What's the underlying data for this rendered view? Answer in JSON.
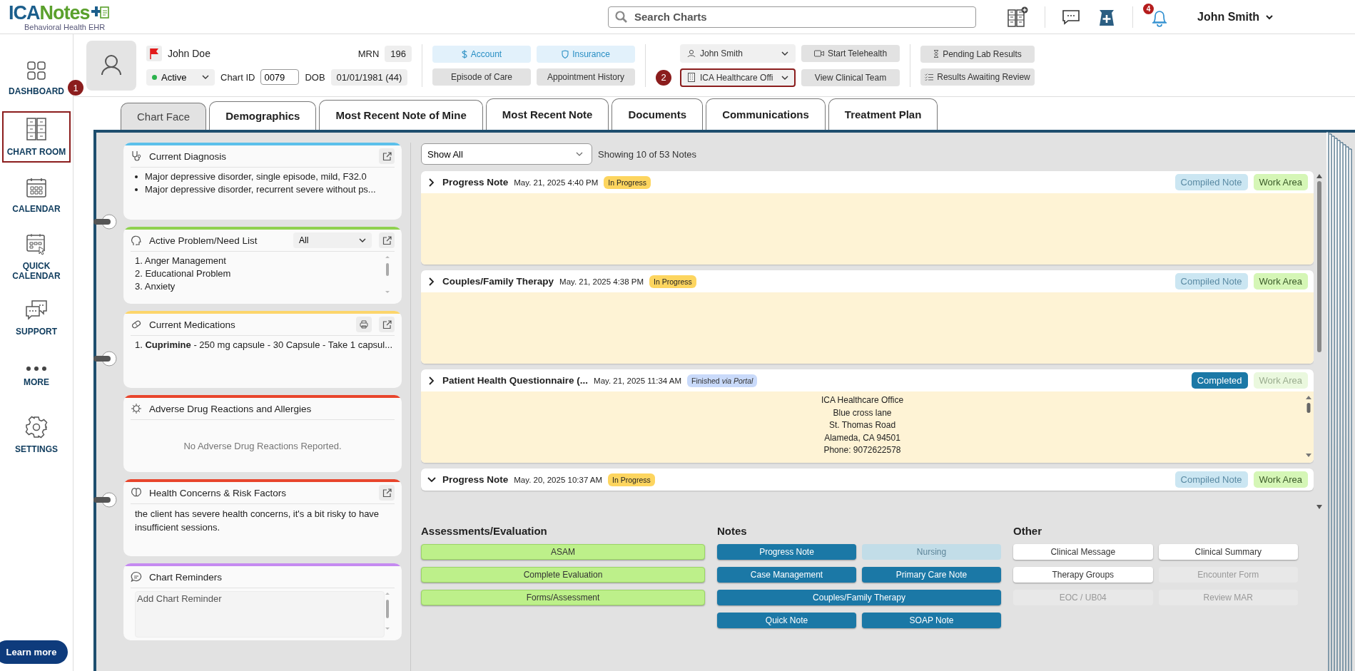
{
  "header": {
    "logo": {
      "brand_1": "ICA",
      "brand_2": "Notes",
      "tagline": "Behavioral Health EHR"
    },
    "search": {
      "placeholder": "Search Charts"
    },
    "notification_count": "4",
    "user": "John Smith"
  },
  "sidebar": {
    "items": [
      {
        "label": "DASHBOARD",
        "kind": "dashboard",
        "highlighted": false
      },
      {
        "label": "CHART ROOM",
        "kind": "chartroom",
        "highlighted": true
      },
      {
        "label": "CALENDAR",
        "kind": "calendar",
        "highlighted": false
      },
      {
        "label": "QUICK CALENDAR",
        "kind": "quickcal",
        "highlighted": false
      },
      {
        "label": "SUPPORT",
        "kind": "support",
        "highlighted": false
      },
      {
        "label": "MORE",
        "kind": "more",
        "highlighted": false
      },
      {
        "label": "SETTINGS",
        "kind": "settings",
        "highlighted": false
      }
    ],
    "learn_more": "Learn more"
  },
  "callouts": [
    "1",
    "2"
  ],
  "patient": {
    "name": "John Doe",
    "flagged": true,
    "status": "Active",
    "chart_id_label": "Chart ID",
    "chart_id": "0079",
    "mrn_label": "MRN",
    "mrn": "196",
    "dob_label": "DOB",
    "dob": "01/01/1981 (44)"
  },
  "patient_actions": {
    "account": "Account",
    "insurance": "Insurance",
    "episode": "Episode of Care",
    "appointments": "Appointment History",
    "clinician": "John Smith",
    "office": {
      "value": "ICA Healthcare Offi",
      "highlighted": true
    },
    "telehealth": "Start Telehealth",
    "clinical_team": "View Clinical Team",
    "pending_labs": "Pending Lab Results",
    "results_review": "Results Awaiting Review"
  },
  "tabs": [
    {
      "label": "Chart Face",
      "selected": true
    },
    {
      "label": "Demographics",
      "selected": false
    },
    {
      "label": "Most Recent Note of Mine",
      "selected": false
    },
    {
      "label": "Most Recent Note",
      "selected": false
    },
    {
      "label": "Documents",
      "selected": false
    },
    {
      "label": "Communications",
      "selected": false
    },
    {
      "label": "Treatment Plan",
      "selected": false
    }
  ],
  "cards": [
    {
      "kind": "diagnosis",
      "title": "Current Diagnosis",
      "color": "#5bc0eb",
      "items": [
        "Major depressive disorder, single episode, mild, F32.0",
        "Major depressive disorder, recurrent severe without ps..."
      ]
    },
    {
      "kind": "problems",
      "title": "Active Problem/Need List",
      "color": "#8fd14f",
      "filter": "All",
      "items": [
        "1. Anger Management",
        "2. Educational Problem",
        "3. Anxiety"
      ]
    },
    {
      "kind": "medications",
      "title": "Current Medications",
      "color": "#fcd56b",
      "items": [
        "1. **Cuprimine** - 250 mg capsule - 30 Capsule - Take 1 capsul..."
      ]
    },
    {
      "kind": "allergies",
      "title": "Adverse Drug Reactions and Allergies",
      "color": "#e8452c",
      "message": "No Adverse Drug Reactions Reported."
    },
    {
      "kind": "concerns",
      "title": "Health Concerns & Risk Factors",
      "color": "#e8452c",
      "text": "the client has severe health concerns, it's a bit risky to have insufficient sessions."
    },
    {
      "kind": "reminders",
      "title": "Chart Reminders",
      "color": "#c58af0",
      "placeholder": "Add Chart Reminder"
    }
  ],
  "notes_filter": {
    "value": "Show All",
    "summary": "Showing 10 of 53 Notes"
  },
  "notes": [
    {
      "title": "Progress Note",
      "date": "May. 21, 2025 4:40 PM",
      "status": {
        "text": "In Progress",
        "kind": "in_progress"
      },
      "expanded": false,
      "actions": [
        {
          "label": "Compiled Note",
          "kind": "compiled",
          "disabled": true
        },
        {
          "label": "Work Area",
          "kind": "work",
          "disabled": false
        }
      ],
      "preview_shown": true
    },
    {
      "title": "Couples/Family Therapy",
      "date": "May. 21, 2025 4:38 PM",
      "status": {
        "text": "In Progress",
        "kind": "in_progress"
      },
      "expanded": false,
      "actions": [
        {
          "label": "Compiled Note",
          "kind": "compiled",
          "disabled": true
        },
        {
          "label": "Work Area",
          "kind": "work",
          "disabled": false
        }
      ],
      "preview_shown": true
    },
    {
      "title": "Patient Health Questionnaire (...",
      "date": "May. 21, 2025 11:34 AM",
      "status": {
        "text": "Finished *via Portal*",
        "kind": "finished"
      },
      "expanded": false,
      "actions": [
        {
          "label": "Completed",
          "kind": "completed",
          "disabled": false
        },
        {
          "label": "Work Area",
          "kind": "work",
          "disabled": true
        }
      ],
      "preview_shown": true,
      "body": [
        "ICA Healthcare Office",
        "Blue cross lane",
        "St. Thomas Road",
        "Alameda, CA 94501",
        "Phone: 9072622578"
      ]
    },
    {
      "title": "Progress Note",
      "date": "May. 20, 2025 10:37 AM",
      "status": {
        "text": "In Progress",
        "kind": "in_progress"
      },
      "expanded": true,
      "actions": [
        {
          "label": "Compiled Note",
          "kind": "compiled",
          "disabled": true
        },
        {
          "label": "Work Area",
          "kind": "work",
          "disabled": false
        }
      ],
      "preview_shown": false
    }
  ],
  "groups": [
    {
      "title": "Assessments/Evaluation",
      "kind": "assessment",
      "buttons": [
        {
          "label": "ASAM",
          "disabled": false,
          "wide": true
        },
        {
          "label": "Complete Evaluation",
          "disabled": false,
          "wide": true
        },
        {
          "label": "Forms/Assessment",
          "disabled": false,
          "wide": true
        }
      ]
    },
    {
      "title": "Notes",
      "kind": "notes",
      "buttons": [
        {
          "label": "Progress Note",
          "disabled": false,
          "wide": false
        },
        {
          "label": "Nursing",
          "disabled": true,
          "wide": false
        },
        {
          "label": "Case Management",
          "disabled": false,
          "wide": false
        },
        {
          "label": "Primary Care Note",
          "disabled": false,
          "wide": false
        },
        {
          "label": "Couples/Family Therapy",
          "disabled": false,
          "wide": true
        },
        {
          "label": "Quick Note",
          "disabled": false,
          "wide": false
        },
        {
          "label": "SOAP Note",
          "disabled": false,
          "wide": false
        }
      ]
    },
    {
      "title": "Other",
      "kind": "other",
      "buttons": [
        {
          "label": "Clinical Message",
          "disabled": false,
          "wide": false
        },
        {
          "label": "Clinical Summary",
          "disabled": false,
          "wide": false
        },
        {
          "label": "Therapy Groups",
          "disabled": false,
          "wide": false
        },
        {
          "label": "Encounter Form",
          "disabled": true,
          "wide": false
        },
        {
          "label": "EOC / UB04",
          "disabled": true,
          "wide": false
        },
        {
          "label": "Review MAR",
          "disabled": true,
          "wide": false
        }
      ]
    }
  ]
}
